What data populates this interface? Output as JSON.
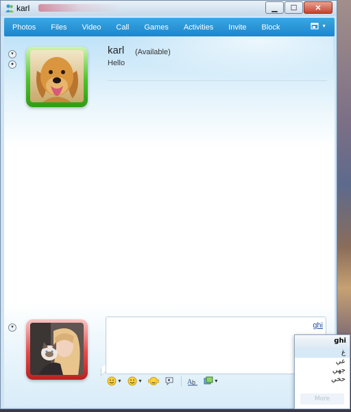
{
  "window": {
    "title": "karl"
  },
  "caption_buttons": {
    "minimize": "▁",
    "maximize": "☐",
    "close": "✕"
  },
  "menu": {
    "items": [
      "Photos",
      "Files",
      "Video",
      "Call",
      "Games",
      "Activities",
      "Invite",
      "Block"
    ],
    "right_icon": "layout-icon"
  },
  "contact": {
    "name": "karl",
    "status": "(Available)",
    "message": "Hello",
    "frame_color": "#4ec22a"
  },
  "me": {
    "frame_color": "#e34a4a"
  },
  "input": {
    "typed_text": "ghi"
  },
  "toolbar": {
    "emoticon_icon": "emoticon-icon",
    "wink_icon": "wink-icon",
    "nudge_icon": "nudge-icon",
    "voice_clip_icon": "voice-clip-icon",
    "font_icon": "font-icon",
    "background_icon": "background-icon"
  },
  "ime": {
    "header": "ghi",
    "candidates": [
      "غ",
      "عي",
      "جهي",
      "حخي"
    ],
    "more_label": "More"
  }
}
